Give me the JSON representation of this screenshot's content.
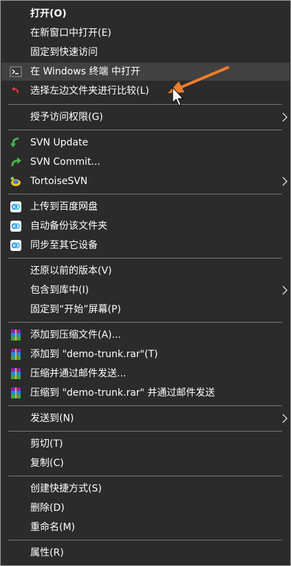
{
  "menu": {
    "open": "打开(O)",
    "open_new_window": "在新窗口中打开(E)",
    "pin_quick_access": "固定到快速访问",
    "open_in_terminal": "在 Windows 终端 中打开",
    "compare_left_folder": "选择左边文件夹进行比较(L)",
    "grant_access": "授予访问权限(G)",
    "svn_update": "SVN Update",
    "svn_commit": "SVN Commit...",
    "tortoisesvn": "TortoiseSVN",
    "upload_baidu": "上传到百度网盘",
    "auto_backup": "自动备份该文件夹",
    "sync_devices": "同步至其它设备",
    "restore_versions": "还原以前的版本(V)",
    "include_library": "包含到库中(I)",
    "pin_start": "固定到“开始”屏幕(P)",
    "add_archive": "添加到压缩文件(A)...",
    "add_to_rar": "添加到 \"demo-trunk.rar\"(T)",
    "compress_email": "压缩并通过邮件发送...",
    "compress_rar_email": "压缩到 \"demo-trunk.rar\" 并通过邮件发送",
    "send_to": "发送到(N)",
    "cut": "剪切(T)",
    "copy": "复制(C)",
    "create_shortcut": "创建快捷方式(S)",
    "delete": "删除(D)",
    "rename": "重命名(M)",
    "properties": "属性(R)"
  },
  "colors": {
    "menu_bg": "#2b2b2b",
    "highlight": "#414141",
    "separator": "#7a7a7a",
    "text": "#ffffff",
    "annotation_arrow": "#f07c2a"
  },
  "icons": {
    "open_in_terminal": "terminal-icon",
    "compare_left_folder": "compare-icon",
    "svn_update": "svn-update-icon",
    "svn_commit": "svn-commit-icon",
    "tortoisesvn": "tortoisesvn-icon",
    "baidu": "baidu-netdisk-icon",
    "winrar": "winrar-icon",
    "submenu": "chevron-right-icon"
  }
}
